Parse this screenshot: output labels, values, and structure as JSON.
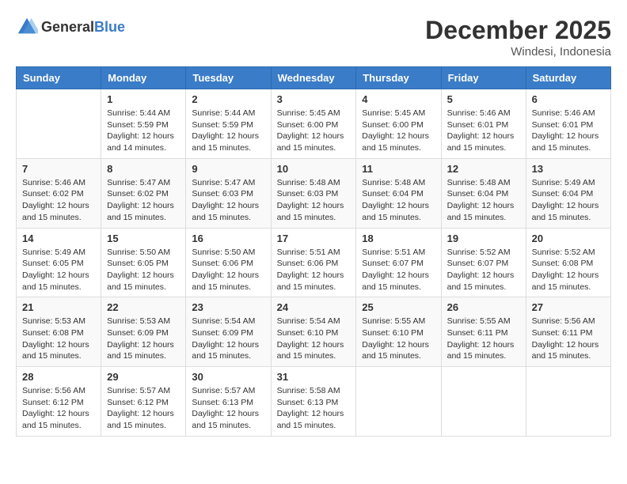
{
  "logo": {
    "general": "General",
    "blue": "Blue"
  },
  "title": {
    "month": "December 2025",
    "location": "Windesi, Indonesia"
  },
  "headers": [
    "Sunday",
    "Monday",
    "Tuesday",
    "Wednesday",
    "Thursday",
    "Friday",
    "Saturday"
  ],
  "weeks": [
    [
      {
        "day": "",
        "sunrise": "",
        "sunset": "",
        "daylight": ""
      },
      {
        "day": "1",
        "sunrise": "Sunrise: 5:44 AM",
        "sunset": "Sunset: 5:59 PM",
        "daylight": "Daylight: 12 hours and 14 minutes."
      },
      {
        "day": "2",
        "sunrise": "Sunrise: 5:44 AM",
        "sunset": "Sunset: 5:59 PM",
        "daylight": "Daylight: 12 hours and 15 minutes."
      },
      {
        "day": "3",
        "sunrise": "Sunrise: 5:45 AM",
        "sunset": "Sunset: 6:00 PM",
        "daylight": "Daylight: 12 hours and 15 minutes."
      },
      {
        "day": "4",
        "sunrise": "Sunrise: 5:45 AM",
        "sunset": "Sunset: 6:00 PM",
        "daylight": "Daylight: 12 hours and 15 minutes."
      },
      {
        "day": "5",
        "sunrise": "Sunrise: 5:46 AM",
        "sunset": "Sunset: 6:01 PM",
        "daylight": "Daylight: 12 hours and 15 minutes."
      },
      {
        "day": "6",
        "sunrise": "Sunrise: 5:46 AM",
        "sunset": "Sunset: 6:01 PM",
        "daylight": "Daylight: 12 hours and 15 minutes."
      }
    ],
    [
      {
        "day": "7",
        "sunrise": "Sunrise: 5:46 AM",
        "sunset": "Sunset: 6:02 PM",
        "daylight": "Daylight: 12 hours and 15 minutes."
      },
      {
        "day": "8",
        "sunrise": "Sunrise: 5:47 AM",
        "sunset": "Sunset: 6:02 PM",
        "daylight": "Daylight: 12 hours and 15 minutes."
      },
      {
        "day": "9",
        "sunrise": "Sunrise: 5:47 AM",
        "sunset": "Sunset: 6:03 PM",
        "daylight": "Daylight: 12 hours and 15 minutes."
      },
      {
        "day": "10",
        "sunrise": "Sunrise: 5:48 AM",
        "sunset": "Sunset: 6:03 PM",
        "daylight": "Daylight: 12 hours and 15 minutes."
      },
      {
        "day": "11",
        "sunrise": "Sunrise: 5:48 AM",
        "sunset": "Sunset: 6:04 PM",
        "daylight": "Daylight: 12 hours and 15 minutes."
      },
      {
        "day": "12",
        "sunrise": "Sunrise: 5:48 AM",
        "sunset": "Sunset: 6:04 PM",
        "daylight": "Daylight: 12 hours and 15 minutes."
      },
      {
        "day": "13",
        "sunrise": "Sunrise: 5:49 AM",
        "sunset": "Sunset: 6:04 PM",
        "daylight": "Daylight: 12 hours and 15 minutes."
      }
    ],
    [
      {
        "day": "14",
        "sunrise": "Sunrise: 5:49 AM",
        "sunset": "Sunset: 6:05 PM",
        "daylight": "Daylight: 12 hours and 15 minutes."
      },
      {
        "day": "15",
        "sunrise": "Sunrise: 5:50 AM",
        "sunset": "Sunset: 6:05 PM",
        "daylight": "Daylight: 12 hours and 15 minutes."
      },
      {
        "day": "16",
        "sunrise": "Sunrise: 5:50 AM",
        "sunset": "Sunset: 6:06 PM",
        "daylight": "Daylight: 12 hours and 15 minutes."
      },
      {
        "day": "17",
        "sunrise": "Sunrise: 5:51 AM",
        "sunset": "Sunset: 6:06 PM",
        "daylight": "Daylight: 12 hours and 15 minutes."
      },
      {
        "day": "18",
        "sunrise": "Sunrise: 5:51 AM",
        "sunset": "Sunset: 6:07 PM",
        "daylight": "Daylight: 12 hours and 15 minutes."
      },
      {
        "day": "19",
        "sunrise": "Sunrise: 5:52 AM",
        "sunset": "Sunset: 6:07 PM",
        "daylight": "Daylight: 12 hours and 15 minutes."
      },
      {
        "day": "20",
        "sunrise": "Sunrise: 5:52 AM",
        "sunset": "Sunset: 6:08 PM",
        "daylight": "Daylight: 12 hours and 15 minutes."
      }
    ],
    [
      {
        "day": "21",
        "sunrise": "Sunrise: 5:53 AM",
        "sunset": "Sunset: 6:08 PM",
        "daylight": "Daylight: 12 hours and 15 minutes."
      },
      {
        "day": "22",
        "sunrise": "Sunrise: 5:53 AM",
        "sunset": "Sunset: 6:09 PM",
        "daylight": "Daylight: 12 hours and 15 minutes."
      },
      {
        "day": "23",
        "sunrise": "Sunrise: 5:54 AM",
        "sunset": "Sunset: 6:09 PM",
        "daylight": "Daylight: 12 hours and 15 minutes."
      },
      {
        "day": "24",
        "sunrise": "Sunrise: 5:54 AM",
        "sunset": "Sunset: 6:10 PM",
        "daylight": "Daylight: 12 hours and 15 minutes."
      },
      {
        "day": "25",
        "sunrise": "Sunrise: 5:55 AM",
        "sunset": "Sunset: 6:10 PM",
        "daylight": "Daylight: 12 hours and 15 minutes."
      },
      {
        "day": "26",
        "sunrise": "Sunrise: 5:55 AM",
        "sunset": "Sunset: 6:11 PM",
        "daylight": "Daylight: 12 hours and 15 minutes."
      },
      {
        "day": "27",
        "sunrise": "Sunrise: 5:56 AM",
        "sunset": "Sunset: 6:11 PM",
        "daylight": "Daylight: 12 hours and 15 minutes."
      }
    ],
    [
      {
        "day": "28",
        "sunrise": "Sunrise: 5:56 AM",
        "sunset": "Sunset: 6:12 PM",
        "daylight": "Daylight: 12 hours and 15 minutes."
      },
      {
        "day": "29",
        "sunrise": "Sunrise: 5:57 AM",
        "sunset": "Sunset: 6:12 PM",
        "daylight": "Daylight: 12 hours and 15 minutes."
      },
      {
        "day": "30",
        "sunrise": "Sunrise: 5:57 AM",
        "sunset": "Sunset: 6:13 PM",
        "daylight": "Daylight: 12 hours and 15 minutes."
      },
      {
        "day": "31",
        "sunrise": "Sunrise: 5:58 AM",
        "sunset": "Sunset: 6:13 PM",
        "daylight": "Daylight: 12 hours and 15 minutes."
      },
      {
        "day": "",
        "sunrise": "",
        "sunset": "",
        "daylight": ""
      },
      {
        "day": "",
        "sunrise": "",
        "sunset": "",
        "daylight": ""
      },
      {
        "day": "",
        "sunrise": "",
        "sunset": "",
        "daylight": ""
      }
    ]
  ]
}
